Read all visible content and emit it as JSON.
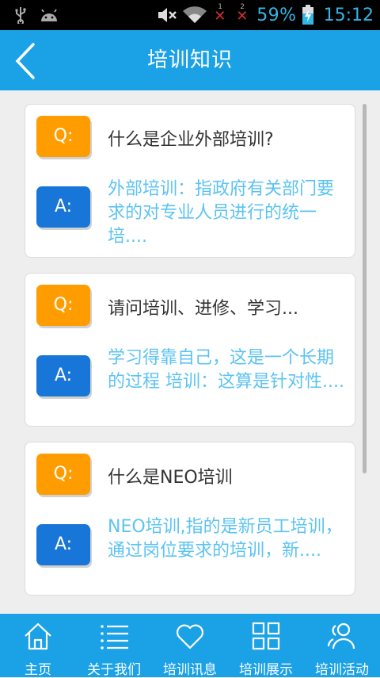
{
  "status_bar": {
    "sim1_index": "1",
    "sim2_index": "2",
    "battery_percent": "59%",
    "time": "15:12",
    "icons": [
      "usb-icon",
      "android-icon",
      "mute-icon",
      "wifi-icon",
      "sim-no-signal-icon",
      "battery-charging-icon"
    ]
  },
  "header": {
    "title": "培训知识",
    "back_icon": "chevron-left-icon"
  },
  "qa_items": [
    {
      "q_label": "Q:",
      "a_label": "A:",
      "question": "什么是企业外部培训?",
      "answer": "外部培训：指政府有关部门要求的对专业人员进行的统一培...."
    },
    {
      "q_label": "Q:",
      "a_label": "A:",
      "question": "请问培训、进修、学习...",
      "answer": "学习得靠自己，这是一个长期的过程 培训：这算是针对性...."
    },
    {
      "q_label": "Q:",
      "a_label": "A:",
      "question": "什么是NEO培训",
      "answer": "NEO培训,指的是新员工培训，通过岗位要求的培训，新...."
    }
  ],
  "bottom_nav": [
    {
      "label": "主页",
      "icon": "home-icon"
    },
    {
      "label": "关于我们",
      "icon": "list-icon"
    },
    {
      "label": "培训讯息",
      "icon": "heart-icon"
    },
    {
      "label": "培训展示",
      "icon": "grid-icon"
    },
    {
      "label": "培训活动",
      "icon": "users-icon"
    }
  ],
  "colors": {
    "header_bg": "#1ba2e6",
    "q_badge": "#ff9c00",
    "a_badge": "#1876d8",
    "answer_text": "#5cc3f2",
    "status_text": "#33b5e5"
  }
}
